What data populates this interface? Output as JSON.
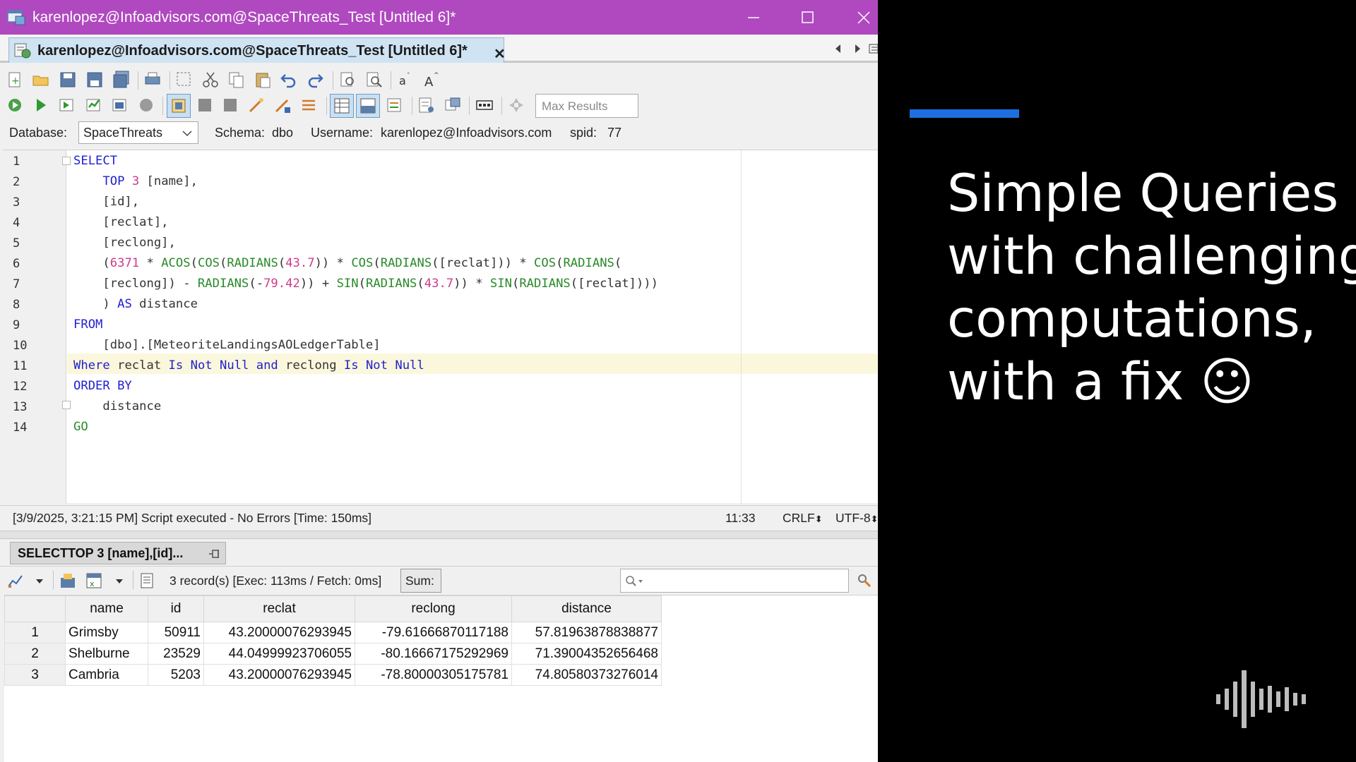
{
  "window": {
    "title": "karenlopez@Infoadvisors.com@SpaceThreats_Test [Untitled 6]*"
  },
  "document_tab": {
    "label": "karenlopez@Infoadvisors.com@SpaceThreats_Test [Untitled 6]*"
  },
  "toolbar": {
    "max_results_placeholder": "Max Results"
  },
  "connection": {
    "database_label": "Database:",
    "database_value": "SpaceThreats",
    "schema_label": "Schema:",
    "schema_value": "dbo",
    "username_label": "Username:",
    "username_value": "karenlopez@Infoadvisors.com",
    "spid_label": "spid:",
    "spid_value": "77"
  },
  "editor": {
    "line_numbers": [
      "1",
      "2",
      "3",
      "4",
      "5",
      "6",
      "7",
      "8",
      "9",
      "10",
      "11",
      "12",
      "13",
      "14"
    ],
    "lines": [
      [
        {
          "t": "SELECT",
          "c": "kw"
        }
      ],
      [
        {
          "t": "    ",
          "c": "txt"
        },
        {
          "t": "TOP",
          "c": "kw"
        },
        {
          "t": " ",
          "c": "txt"
        },
        {
          "t": "3",
          "c": "num"
        },
        {
          "t": " [name],",
          "c": "txt"
        }
      ],
      [
        {
          "t": "    [id],",
          "c": "txt"
        }
      ],
      [
        {
          "t": "    [reclat],",
          "c": "txt"
        }
      ],
      [
        {
          "t": "    [reclong],",
          "c": "txt"
        }
      ],
      [
        {
          "t": "    (",
          "c": "txt"
        },
        {
          "t": "6371",
          "c": "num"
        },
        {
          "t": " * ",
          "c": "txt"
        },
        {
          "t": "ACOS",
          "c": "fn"
        },
        {
          "t": "(",
          "c": "txt"
        },
        {
          "t": "COS",
          "c": "fn"
        },
        {
          "t": "(",
          "c": "txt"
        },
        {
          "t": "RADIANS",
          "c": "fn"
        },
        {
          "t": "(",
          "c": "txt"
        },
        {
          "t": "43.7",
          "c": "num"
        },
        {
          "t": ")) * ",
          "c": "txt"
        },
        {
          "t": "COS",
          "c": "fn"
        },
        {
          "t": "(",
          "c": "txt"
        },
        {
          "t": "RADIANS",
          "c": "fn"
        },
        {
          "t": "([reclat])) * ",
          "c": "txt"
        },
        {
          "t": "COS",
          "c": "fn"
        },
        {
          "t": "(",
          "c": "txt"
        },
        {
          "t": "RADIANS",
          "c": "fn"
        },
        {
          "t": "(",
          "c": "txt"
        }
      ],
      [
        {
          "t": "    [reclong]) - ",
          "c": "txt"
        },
        {
          "t": "RADIANS",
          "c": "fn"
        },
        {
          "t": "(-",
          "c": "txt"
        },
        {
          "t": "79.42",
          "c": "num"
        },
        {
          "t": ")) + ",
          "c": "txt"
        },
        {
          "t": "SIN",
          "c": "fn"
        },
        {
          "t": "(",
          "c": "txt"
        },
        {
          "t": "RADIANS",
          "c": "fn"
        },
        {
          "t": "(",
          "c": "txt"
        },
        {
          "t": "43.7",
          "c": "num"
        },
        {
          "t": ")) * ",
          "c": "txt"
        },
        {
          "t": "SIN",
          "c": "fn"
        },
        {
          "t": "(",
          "c": "txt"
        },
        {
          "t": "RADIANS",
          "c": "fn"
        },
        {
          "t": "([reclat])))",
          "c": "txt"
        }
      ],
      [
        {
          "t": "    ) ",
          "c": "txt"
        },
        {
          "t": "AS",
          "c": "kw"
        },
        {
          "t": " distance",
          "c": "txt"
        }
      ],
      [
        {
          "t": "FROM",
          "c": "kw"
        }
      ],
      [
        {
          "t": "    [dbo].[MeteoriteLandingsAOLedgerTable]",
          "c": "txt"
        }
      ],
      [
        {
          "t": "Where",
          "c": "kw"
        },
        {
          "t": " reclat ",
          "c": "txt"
        },
        {
          "t": "Is Not Null and",
          "c": "kw"
        },
        {
          "t": " reclong ",
          "c": "txt"
        },
        {
          "t": "Is Not Null",
          "c": "kw"
        }
      ],
      [
        {
          "t": "ORDER BY",
          "c": "kw"
        }
      ],
      [
        {
          "t": "    distance",
          "c": "txt"
        }
      ],
      [
        {
          "t": "GO",
          "c": "fn"
        }
      ]
    ]
  },
  "status": {
    "message": "[3/9/2025, 3:21:15 PM] Script executed - No Errors [Time: 150ms]",
    "cursor": "11:33",
    "line_ending": "CRLF",
    "encoding": "UTF-8"
  },
  "results": {
    "tab_label": "SELECTTOP 3 [name],[id]...",
    "record_info": "3 record(s) [Exec: 113ms / Fetch: 0ms]",
    "sum_label": "Sum:",
    "columns": [
      "name",
      "id",
      "reclat",
      "reclong",
      "distance"
    ],
    "rows": [
      {
        "num": "1",
        "cells": [
          "Grimsby",
          "50911",
          "43.20000076293945",
          "-79.61666870117188",
          "57.81963878838877"
        ]
      },
      {
        "num": "2",
        "cells": [
          "Shelburne",
          "23529",
          "44.04999923706055",
          "-80.16667175292969",
          "71.39004352656468"
        ]
      },
      {
        "num": "3",
        "cells": [
          "Cambria",
          "5203",
          "43.20000076293945",
          "-78.80000305175781",
          "74.80580373276014"
        ]
      }
    ]
  },
  "slide": {
    "title_lines": [
      "Simple Queries",
      "with challenging",
      "computations,",
      "with a fix ☺"
    ],
    "accent_color": "#1e6ee0"
  },
  "colors": {
    "titlebar": "#b048c0",
    "keyword": "#1f1fd0",
    "function": "#2a8a2a",
    "number": "#d03a8a"
  }
}
